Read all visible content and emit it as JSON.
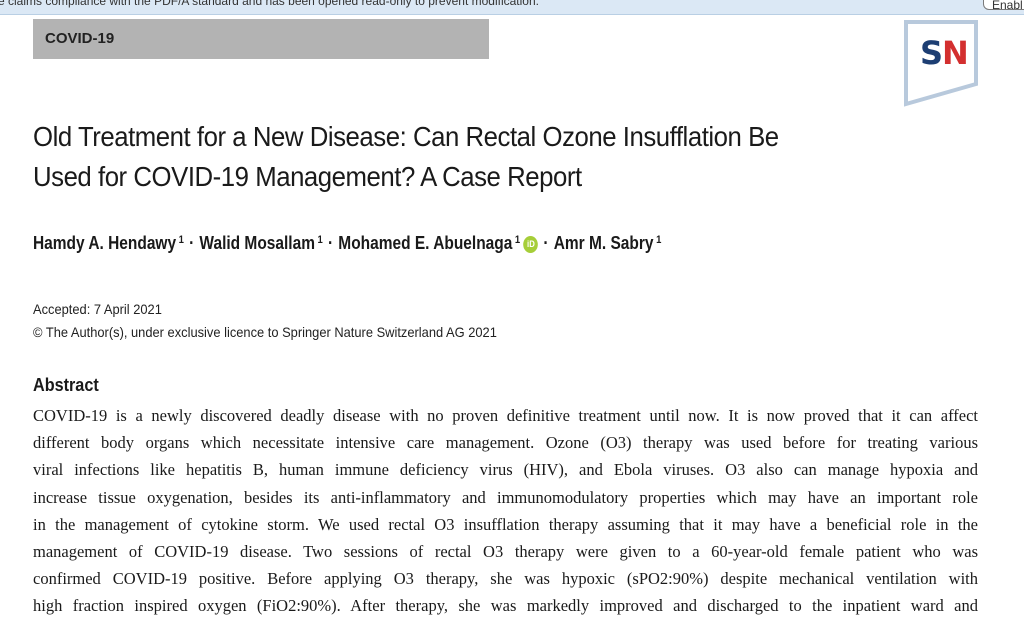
{
  "notification": {
    "message": "e claims compliance with the PDF/A standard and has been opened read-only to prevent modification.",
    "enable_label": "Enabl"
  },
  "header": {
    "category": "COVID-19",
    "logo_text_s": "S",
    "logo_text_n": "N"
  },
  "article": {
    "title_line1": "Old Treatment for a New Disease: Can Rectal Ozone Insufflation Be",
    "title_line2": "Used for COVID-19 Management? A Case Report",
    "authors": [
      {
        "name": "Hamdy A. Hendawy",
        "affil": "1"
      },
      {
        "name": "Walid Mosallam",
        "affil": "1"
      },
      {
        "name": "Mohamed E. Abuelnaga",
        "affil": "1"
      },
      {
        "name": "Amr M. Sabry",
        "affil": "1"
      }
    ],
    "separator": "·",
    "orcid_label": "iD",
    "accepted": "Accepted: 7 April 2021",
    "copyright": "© The Author(s), under exclusive licence to Springer Nature Switzerland AG 2021"
  },
  "abstract": {
    "heading": "Abstract",
    "lines": [
      "COVID-19 is a newly discovered deadly disease with no proven definitive treatment until now. It is now proved that it can affect",
      "different body organs which necessitate intensive care management. Ozone (O3) therapy was used before for treating various",
      "viral infections like hepatitis B, human immune deficiency virus (HIV), and Ebola viruses. O3 also can manage hypoxia and",
      "increase tissue oxygenation, besides its anti-inflammatory and immunomodulatory properties which may have an important role",
      "in the management of cytokine storm. We used rectal O3 insufflation therapy assuming that it may have a beneficial role in the",
      "management of COVID-19 disease. Two sessions of rectal O3 therapy were given to a 60-year-old female patient who was",
      "confirmed COVID-19 positive. Before applying O3 therapy, she was hypoxic (sPO2:90%) despite mechanical ventilation with",
      "high fraction inspired oxygen (FiO2:90%). After therapy, she was markedly improved and discharged to the inpatient ward and"
    ]
  },
  "colors": {
    "category_bar": "#b3b3b3",
    "logo_blue": "#1d3e73",
    "logo_red": "#d32f2f",
    "orcid_green": "#a6ce39",
    "notice_bg": "#dbe8f5"
  }
}
